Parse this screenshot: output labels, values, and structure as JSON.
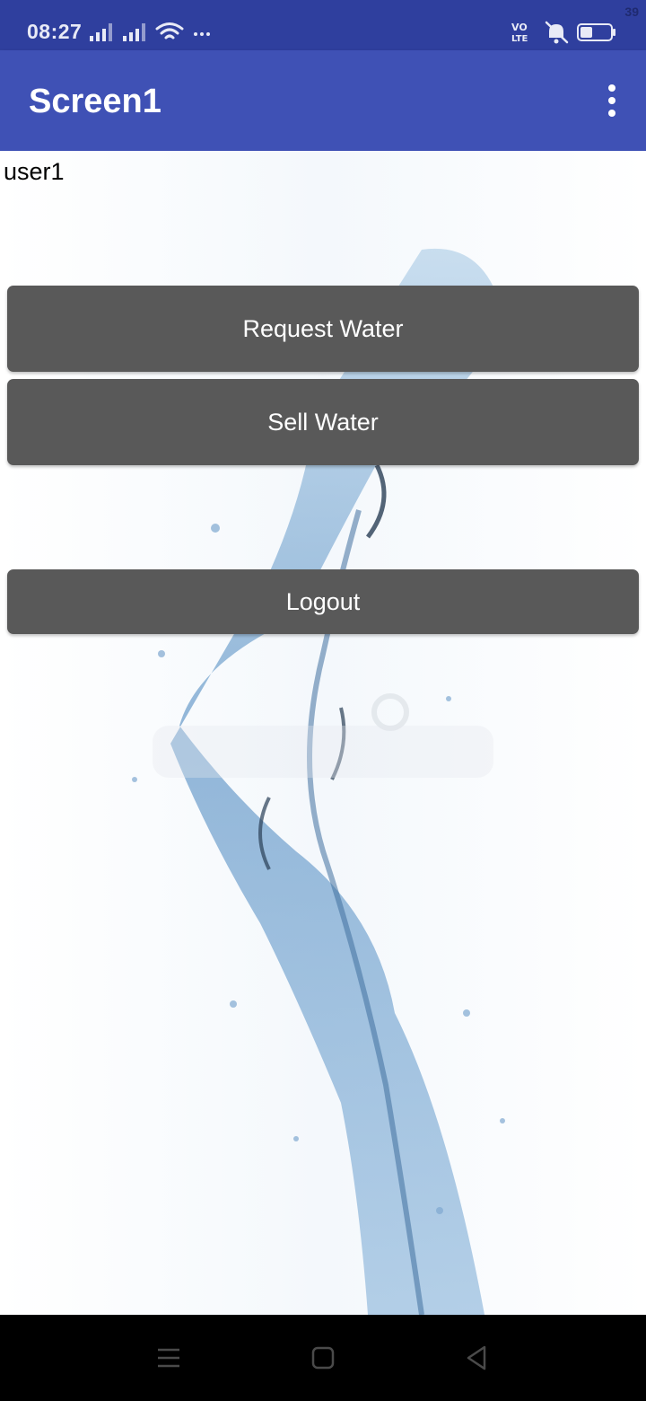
{
  "status_bar": {
    "time": "08:27",
    "battery": "39",
    "icons": [
      "signal-icon",
      "signal-icon",
      "wifi-icon",
      "more-icon",
      "volte-icon",
      "mute-icon",
      "battery-icon"
    ]
  },
  "app_bar": {
    "title": "Screen1",
    "menu_icon": "overflow-menu-icon"
  },
  "main": {
    "username": "user1",
    "buttons": {
      "request": "Request Water",
      "sell": "Sell Water",
      "logout": "Logout"
    },
    "background_image": "water-splash"
  },
  "nav_bar": {
    "icons": [
      "recents-icon",
      "home-icon",
      "back-icon"
    ]
  },
  "colors": {
    "status_bar": "#2f3f9e",
    "app_bar": "#3f51b5",
    "button": "#595959",
    "button_text": "#ffffff"
  }
}
